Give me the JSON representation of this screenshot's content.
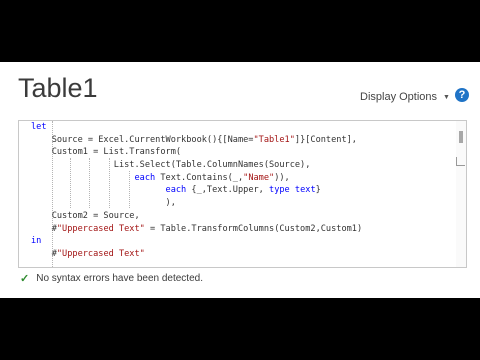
{
  "window": {
    "title": "Table1",
    "display_options_label": "Display Options",
    "help_label": "?"
  },
  "editor": {
    "lines": [
      [
        {
          "t": "let",
          "k": "kw"
        }
      ],
      [
        {
          "t": "    Source = Excel.CurrentWorkbook(){[Name="
        },
        {
          "t": "\"Table1\"",
          "k": "str"
        },
        {
          "t": "]}[Content],"
        }
      ],
      [
        {
          "t": "    Custom1 = List.Transform("
        }
      ],
      [
        {
          "t": "                List.Select(Table.ColumnNames(Source),"
        }
      ],
      [
        {
          "t": "                    "
        },
        {
          "t": "each",
          "k": "kw"
        },
        {
          "t": " Text.Contains(_,"
        },
        {
          "t": "\"Name\"",
          "k": "str"
        },
        {
          "t": ")),"
        }
      ],
      [
        {
          "t": "                          "
        },
        {
          "t": "each",
          "k": "kw"
        },
        {
          "t": " {_,Text.Upper, "
        },
        {
          "t": "type",
          "k": "kw"
        },
        {
          "t": " "
        },
        {
          "t": "text",
          "k": "kw"
        },
        {
          "t": "}"
        }
      ],
      [
        {
          "t": "                          ),"
        }
      ],
      [
        {
          "t": "    Custom2 = Source,"
        }
      ],
      [
        {
          "t": "    #"
        },
        {
          "t": "\"Uppercased Text\"",
          "k": "str"
        },
        {
          "t": " = Table.TransformColumns(Custom2,Custom1)"
        }
      ],
      [
        {
          "t": "in",
          "k": "kw"
        }
      ],
      [
        {
          "t": "    #"
        },
        {
          "t": "\"Uppercased Text\"",
          "k": "str"
        }
      ]
    ]
  },
  "status": {
    "icon": "checkmark-icon",
    "message": "No syntax errors have been detected."
  },
  "colors": {
    "keyword": "#0000ff",
    "string": "#a31515",
    "help_icon": "#1f73c6",
    "check": "#2e8b2e"
  }
}
